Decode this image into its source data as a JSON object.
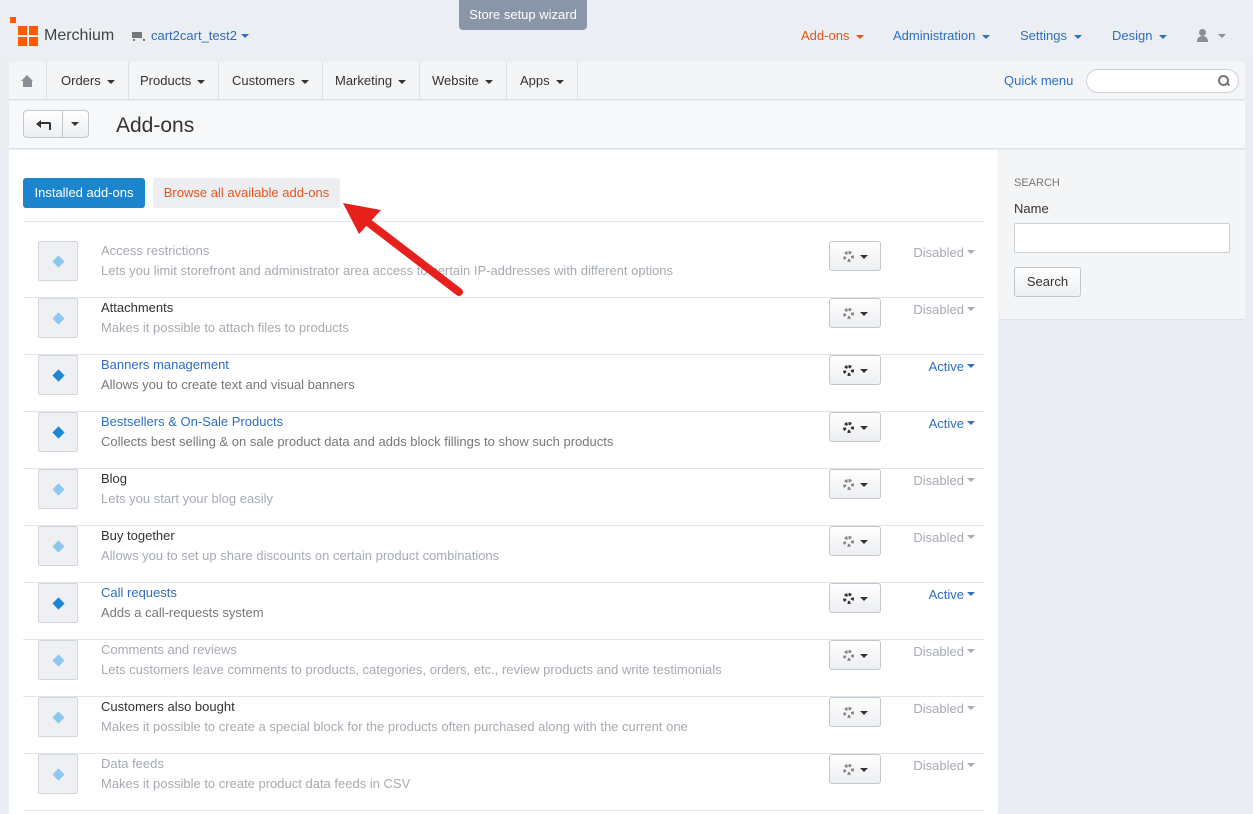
{
  "header": {
    "brand": "Merchium",
    "store": "cart2cart_test2",
    "wizard": "Store setup wizard",
    "nav": [
      {
        "label": "Add-ons",
        "color": "#e8561c"
      },
      {
        "label": "Administration"
      },
      {
        "label": "Settings"
      },
      {
        "label": "Design"
      }
    ]
  },
  "mainnav": {
    "items": [
      "Orders",
      "Products",
      "Customers",
      "Marketing",
      "Website",
      "Apps"
    ],
    "quick_menu": "Quick menu",
    "search_placeholder": ""
  },
  "page": {
    "title": "Add-ons"
  },
  "tabs": {
    "installed": "Installed add-ons",
    "browse": "Browse all available add-ons"
  },
  "addons": [
    {
      "name": "Access restrictions",
      "desc": "Lets you limit storefront and administrator area access to certain IP-addresses with different options",
      "status": "Disabled",
      "state": "disabled"
    },
    {
      "name": "Attachments",
      "desc": "Makes it possible to attach files to products",
      "status": "Disabled",
      "state": "installed"
    },
    {
      "name": "Banners management",
      "desc": "Allows you to create text and visual banners",
      "status": "Active",
      "state": "active"
    },
    {
      "name": "Bestsellers & On-Sale Products",
      "desc": "Collects best selling & on sale product data and adds block fillings to show such products",
      "status": "Active",
      "state": "active"
    },
    {
      "name": "Blog",
      "desc": "Lets you start your blog easily",
      "status": "Disabled",
      "state": "installed"
    },
    {
      "name": "Buy together",
      "desc": "Allows you to set up share discounts on certain product combinations",
      "status": "Disabled",
      "state": "installed"
    },
    {
      "name": "Call requests",
      "desc": "Adds a call-requests system",
      "status": "Active",
      "state": "active"
    },
    {
      "name": "Comments and reviews",
      "desc": "Lets customers leave comments to products, categories, orders, etc., review products and write testimonials",
      "status": "Disabled",
      "state": "disabled"
    },
    {
      "name": "Customers also bought",
      "desc": "Makes it possible to create a special block for the products often purchased along with the current one",
      "status": "Disabled",
      "state": "installed"
    },
    {
      "name": "Data feeds",
      "desc": "Makes it possible to create product data feeds in CSV",
      "status": "Disabled",
      "state": "disabled"
    }
  ],
  "sidebar": {
    "heading": "Search",
    "name_label": "Name",
    "name_value": "",
    "search_button": "Search"
  },
  "colors": {
    "primary": "#1d84ce",
    "accent": "#e8561c",
    "link": "#2f6ec2",
    "annotation_arrow": "#e8201c"
  }
}
